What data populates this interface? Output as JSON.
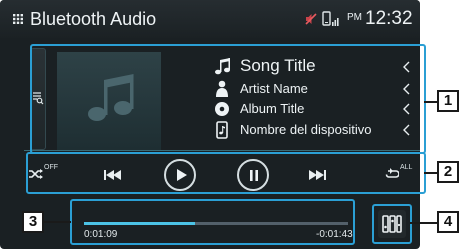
{
  "header": {
    "title": "Bluetooth Audio",
    "ampm": "PM",
    "time": "12:32",
    "icons": [
      "grid-menu-icon",
      "muted-speaker-icon",
      "phone-signal-icon"
    ]
  },
  "track": {
    "title": "Song Title",
    "artist": "Artist Name",
    "album": "Album Title",
    "device": "Nombre del dispositivo"
  },
  "controls": {
    "shuffle_state": "OFF",
    "repeat_state": "ALL",
    "icons": [
      "shuffle-icon",
      "previous-icon",
      "play-icon",
      "pause-icon",
      "next-icon",
      "repeat-icon"
    ]
  },
  "progress": {
    "elapsed": "0:01:09",
    "remaining": "-0:01:43",
    "fraction": 0.42
  },
  "callouts": [
    "1",
    "2",
    "3",
    "4"
  ],
  "colors": {
    "highlight_frame": "#2b9fd4",
    "progress_fill": "#4cc3e6",
    "background": "#1a2023"
  }
}
